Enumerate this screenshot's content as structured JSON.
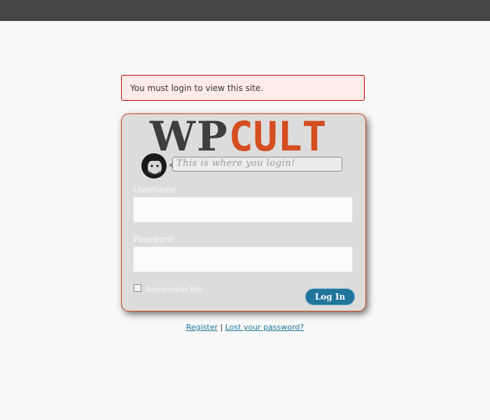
{
  "colors": {
    "topbar": "#464646",
    "page_bg": "#f9f9f9",
    "error_bg": "#ffebe8",
    "error_border": "#c00000",
    "card_bg": "#dcdcdc",
    "card_border": "#cc4a1f",
    "logo_dark": "#3e3e3e",
    "logo_accent": "#d54e21",
    "button_bg": "#21759b",
    "link": "#21759b"
  },
  "error": {
    "message": "You must login to view this site."
  },
  "logo": {
    "part1": "WP",
    "part2": "CULT",
    "image": "avatar-caricature"
  },
  "bubble": {
    "text": "This is where you login!"
  },
  "form": {
    "username_label": "Username",
    "username_value": "",
    "password_label": "Password",
    "password_value": "",
    "remember_label": "Remember Me",
    "remember_checked": false,
    "submit_label": "Log In"
  },
  "footer_links": {
    "register": "Register",
    "separator": "|",
    "lost_password": "Lost your password?"
  }
}
